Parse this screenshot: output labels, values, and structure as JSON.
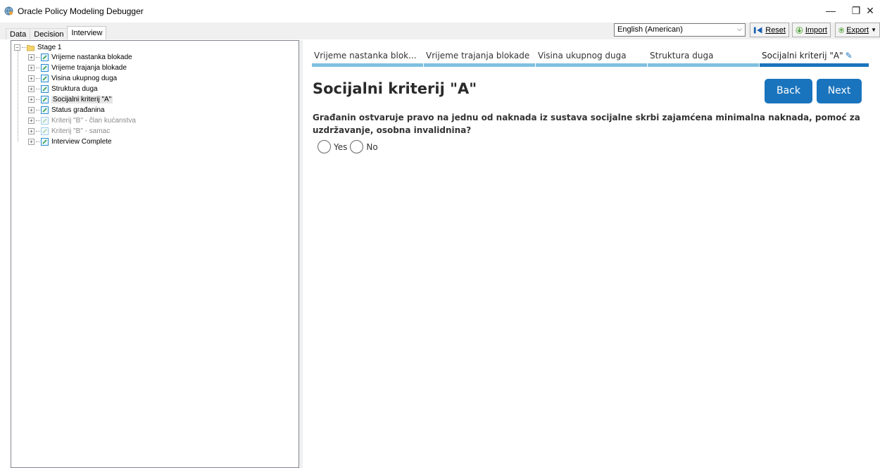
{
  "window": {
    "title": "Oracle Policy Modeling Debugger",
    "controls": {
      "minimize": "—",
      "restore": "❐",
      "close": "✕"
    }
  },
  "toolbar": {
    "tabs": [
      {
        "label": "Data",
        "active": false
      },
      {
        "label": "Decision",
        "active": false
      },
      {
        "label": "Interview",
        "active": true
      }
    ],
    "language": {
      "selected": "English (American)"
    },
    "reset_label": "Reset",
    "import_label": "Import",
    "export_label": "Export"
  },
  "tree": {
    "root": {
      "label": "Stage 1",
      "icon": "folder-icon"
    },
    "items": [
      {
        "label": "Vrijeme nastanka blokade",
        "enabled": true,
        "selected": false
      },
      {
        "label": "Vrijeme trajanja blokade",
        "enabled": true,
        "selected": false
      },
      {
        "label": "Visina ukupnog duga",
        "enabled": true,
        "selected": false
      },
      {
        "label": "Struktura duga",
        "enabled": true,
        "selected": false
      },
      {
        "label": "Socijalni kriterij \"A\"",
        "enabled": true,
        "selected": true
      },
      {
        "label": "Status građanina",
        "enabled": true,
        "selected": false
      },
      {
        "label": "Kriterij \"B\" - član kućanstva",
        "enabled": false,
        "selected": false
      },
      {
        "label": "Kriterij \"B\" - samac",
        "enabled": false,
        "selected": false
      },
      {
        "label": "Interview Complete",
        "enabled": true,
        "selected": false
      }
    ]
  },
  "interview": {
    "stages": [
      {
        "label": "Vrijeme nastanka blok...",
        "current": false
      },
      {
        "label": "Vrijeme trajanja blokade",
        "current": false
      },
      {
        "label": "Visina ukupnog duga",
        "current": false
      },
      {
        "label": "Struktura duga",
        "current": false
      },
      {
        "label": "Socijalni kriterij \"A\"",
        "current": true
      }
    ],
    "heading": "Socijalni kriterij \"A\"",
    "back_label": "Back",
    "next_label": "Next",
    "question": "Građanin ostvaruje pravo na jednu od naknada iz sustava socijalne skrbi zajamćena minimalna naknada, pomoć za uzdržavanje, osobna invalidnina?",
    "options": {
      "yes": "Yes",
      "no": "No"
    }
  },
  "colors": {
    "accent": "#1a74bd",
    "stage_done": "#7fc0e0",
    "disabled_text": "#8a8a8a"
  }
}
